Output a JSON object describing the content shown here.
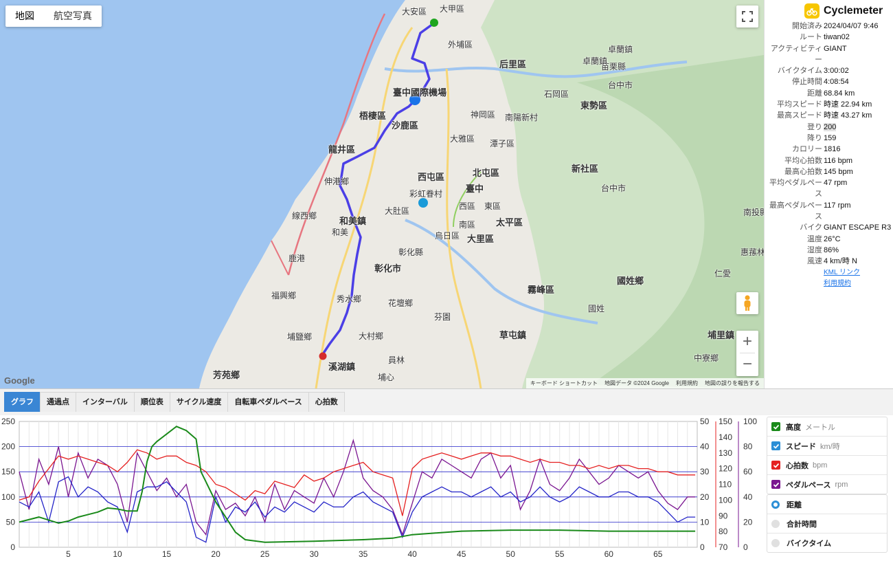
{
  "map": {
    "mode_buttons": [
      "地図",
      "航空写真"
    ],
    "google_label": "Google",
    "attribution": [
      "キーボード ショートカット",
      "地図データ ©2024 Google",
      "利用規約",
      "地図の誤りを報告する"
    ],
    "labels": [
      {
        "t": "大甲區"
      },
      {
        "t": "大安區"
      },
      {
        "t": "外埔區"
      },
      {
        "t": "后里區"
      },
      {
        "t": "卓蘭鎮"
      },
      {
        "t": "苗栗縣"
      },
      {
        "t": "卓蘭鎮"
      },
      {
        "t": "臺中國際機場"
      },
      {
        "t": "石岡區"
      },
      {
        "t": "台中市"
      },
      {
        "t": "梧棲區"
      },
      {
        "t": "沙鹿區"
      },
      {
        "t": "神岡區"
      },
      {
        "t": "南陽新村"
      },
      {
        "t": "東勢區"
      },
      {
        "t": "大雅區"
      },
      {
        "t": "潭子區"
      },
      {
        "t": "龍井區"
      },
      {
        "t": "西屯區"
      },
      {
        "t": "北屯區"
      },
      {
        "t": "新社區"
      },
      {
        "t": "伸港鄉"
      },
      {
        "t": "臺中"
      },
      {
        "t": "彩虹眷村"
      },
      {
        "t": "台中市"
      },
      {
        "t": "線西鄉"
      },
      {
        "t": "大肚區"
      },
      {
        "t": "西區"
      },
      {
        "t": "東區"
      },
      {
        "t": "和美鎮"
      },
      {
        "t": "南區"
      },
      {
        "t": "太平區"
      },
      {
        "t": "和美"
      },
      {
        "t": "烏日區"
      },
      {
        "t": "大里區"
      },
      {
        "t": "南投縣"
      },
      {
        "t": "鹿港"
      },
      {
        "t": "彰化市"
      },
      {
        "t": "彰化縣"
      },
      {
        "t": "霧峰區"
      },
      {
        "t": "國姓鄉"
      },
      {
        "t": "惠蓀林"
      },
      {
        "t": "福興鄉"
      },
      {
        "t": "秀水鄉"
      },
      {
        "t": "花壇鄉"
      },
      {
        "t": "國姓"
      },
      {
        "t": "芬園"
      },
      {
        "t": "埔鹽鄉"
      },
      {
        "t": "大村鄉"
      },
      {
        "t": "草屯鎮"
      },
      {
        "t": "埔里鎮"
      },
      {
        "t": "溪湖鎮"
      },
      {
        "t": "員林"
      },
      {
        "t": "芳苑鄉"
      },
      {
        "t": "埔心"
      },
      {
        "t": "仁愛"
      },
      {
        "t": "中寮鄉"
      }
    ]
  },
  "panel": {
    "brand": "Cyclemeter",
    "stats": [
      {
        "k": "開始済み",
        "v": "2024/04/07 9:46"
      },
      {
        "k": "ルート",
        "v": "tiwan02"
      },
      {
        "k": "アクティビティー",
        "v": "GIANT"
      },
      {
        "k": "バイクタイム",
        "v": "3:00:02"
      },
      {
        "k": "停止時間",
        "v": "4:08:54"
      },
      {
        "k": "距離",
        "v": "68.84 km"
      },
      {
        "k": "平均スピード",
        "v": "時速 22.94 km"
      },
      {
        "k": "最高スピード",
        "v": "時速 43.27 km"
      },
      {
        "k": "登り",
        "v": "200",
        "hl": true
      },
      {
        "k": "降り",
        "v": "159"
      },
      {
        "k": "カロリー",
        "v": "1816"
      },
      {
        "k": "平均心拍数",
        "v": "116 bpm"
      },
      {
        "k": "最高心拍数",
        "v": "145 bpm"
      },
      {
        "k": "平均ペダルペース",
        "v": "47 rpm"
      },
      {
        "k": "最高ペダルペース",
        "v": "117 rpm"
      },
      {
        "k": "バイク",
        "v": "GIANT ESCAPE R3"
      },
      {
        "k": "温度",
        "v": "26°C"
      },
      {
        "k": "湿度",
        "v": "86%"
      },
      {
        "k": "風速",
        "v": "4 km/時 N"
      }
    ],
    "links": [
      "KML リンク",
      "利用規約"
    ]
  },
  "tabs": [
    "グラフ",
    "通過点",
    "インターバル",
    "順位表",
    "サイクル速度",
    "自転車ペダルベース",
    "心拍数"
  ],
  "legend": {
    "series": [
      {
        "name": "高度",
        "unit": "メートル",
        "color": "#1a8a1a"
      },
      {
        "name": "スピード",
        "unit": "km/時",
        "color": "#2c8fd6"
      },
      {
        "name": "心拍数",
        "unit": "bpm",
        "color": "#e52020"
      },
      {
        "name": "ペダルペース",
        "unit": "rpm",
        "color": "#7a1590"
      }
    ],
    "xaxis_options": [
      {
        "name": "距離",
        "selected": true
      },
      {
        "name": "合計時間",
        "selected": false
      },
      {
        "name": "バイクタイム",
        "selected": false
      }
    ]
  },
  "chart_data": {
    "type": "line",
    "xlabel": "",
    "xlim": [
      0,
      69
    ],
    "x_ticks": [
      5,
      10,
      15,
      20,
      25,
      30,
      35,
      40,
      45,
      50,
      55,
      60,
      65
    ],
    "axes": {
      "altitude": {
        "ticks": [
          0,
          50,
          100,
          150,
          200,
          250
        ],
        "lim": [
          0,
          250
        ]
      },
      "speed": {
        "ticks": [
          0,
          10,
          20,
          30,
          40,
          50
        ],
        "lim": [
          0,
          50
        ]
      },
      "heart_rate": {
        "ticks": [
          70,
          80,
          90,
          100,
          110,
          120,
          130,
          140,
          150
        ],
        "lim": [
          70,
          150
        ]
      },
      "cadence": {
        "ticks": [
          0,
          20,
          40,
          60,
          80,
          100
        ],
        "lim": [
          0,
          100
        ]
      }
    },
    "series": [
      {
        "name": "高度",
        "axis": "altitude",
        "x": [
          0,
          2,
          4,
          5,
          6,
          8,
          9,
          10,
          11,
          12,
          12.5,
          13,
          13.5,
          14,
          15,
          16,
          17,
          18,
          18.5,
          19,
          20,
          21,
          22,
          23,
          25,
          30,
          35,
          38,
          40,
          45,
          50,
          55,
          60,
          65,
          68.8
        ],
        "values": [
          50,
          60,
          48,
          52,
          60,
          70,
          78,
          76,
          72,
          72,
          110,
          170,
          200,
          210,
          225,
          240,
          232,
          215,
          150,
          130,
          90,
          60,
          30,
          15,
          10,
          12,
          15,
          18,
          25,
          32,
          34,
          34,
          32,
          32,
          32
        ]
      },
      {
        "name": "スピード",
        "axis": "speed",
        "x": [
          0,
          1,
          2,
          3,
          4,
          5,
          6,
          7,
          8,
          9,
          10,
          11,
          12,
          13,
          14,
          15,
          16,
          17,
          18,
          19,
          20,
          21,
          22,
          23,
          24,
          25,
          26,
          27,
          28,
          29,
          30,
          31,
          32,
          33,
          34,
          35,
          36,
          37,
          38,
          39,
          40,
          41,
          42,
          43,
          44,
          45,
          46,
          47,
          48,
          49,
          50,
          51,
          52,
          53,
          54,
          55,
          56,
          57,
          58,
          59,
          60,
          61,
          62,
          63,
          64,
          65,
          66,
          67,
          68,
          68.8
        ],
        "values": [
          18,
          16,
          22,
          10,
          26,
          28,
          20,
          24,
          22,
          18,
          16,
          6,
          22,
          24,
          24,
          26,
          22,
          18,
          4,
          2,
          20,
          10,
          16,
          14,
          18,
          12,
          16,
          14,
          18,
          16,
          14,
          18,
          16,
          16,
          20,
          22,
          18,
          16,
          14,
          4,
          14,
          20,
          22,
          24,
          22,
          22,
          20,
          22,
          24,
          20,
          22,
          18,
          20,
          24,
          20,
          18,
          20,
          24,
          22,
          20,
          20,
          22,
          22,
          20,
          20,
          18,
          14,
          10,
          12,
          12
        ]
      },
      {
        "name": "心拍数",
        "axis": "heart_rate",
        "x": [
          0,
          1,
          2,
          3,
          4,
          5,
          6,
          7,
          8,
          9,
          10,
          11,
          12,
          13,
          14,
          15,
          16,
          17,
          18,
          19,
          20,
          21,
          22,
          23,
          24,
          25,
          26,
          27,
          28,
          29,
          30,
          31,
          32,
          33,
          34,
          35,
          36,
          37,
          38,
          39,
          40,
          41,
          42,
          43,
          44,
          45,
          46,
          47,
          48,
          49,
          50,
          51,
          52,
          53,
          54,
          55,
          56,
          57,
          58,
          59,
          60,
          61,
          62,
          63,
          64,
          65,
          66,
          67,
          68,
          68.8
        ],
        "values": [
          100,
          102,
          112,
          120,
          128,
          126,
          128,
          126,
          124,
          122,
          118,
          124,
          132,
          130,
          126,
          128,
          128,
          124,
          122,
          118,
          110,
          108,
          104,
          100,
          106,
          104,
          112,
          110,
          108,
          116,
          112,
          114,
          118,
          120,
          122,
          124,
          118,
          116,
          114,
          90,
          120,
          126,
          128,
          130,
          128,
          126,
          128,
          130,
          130,
          128,
          128,
          126,
          124,
          126,
          124,
          124,
          122,
          122,
          120,
          122,
          120,
          122,
          122,
          120,
          120,
          118,
          118,
          116,
          116,
          116
        ]
      },
      {
        "name": "ペダルペース",
        "axis": "cadence",
        "x": [
          0,
          1,
          2,
          3,
          4,
          5,
          6,
          7,
          8,
          9,
          10,
          11,
          12,
          13,
          14,
          15,
          16,
          17,
          18,
          19,
          20,
          21,
          22,
          23,
          24,
          25,
          26,
          27,
          28,
          29,
          30,
          31,
          32,
          33,
          34,
          35,
          36,
          37,
          38,
          39,
          40,
          41,
          42,
          43,
          44,
          45,
          46,
          47,
          48,
          49,
          50,
          51,
          52,
          53,
          54,
          55,
          56,
          57,
          58,
          59,
          60,
          61,
          62,
          63,
          64,
          65,
          66,
          67,
          68,
          68.8
        ],
        "values": [
          60,
          30,
          70,
          50,
          80,
          40,
          75,
          55,
          70,
          65,
          50,
          20,
          75,
          60,
          45,
          55,
          40,
          50,
          20,
          10,
          45,
          30,
          35,
          25,
          40,
          20,
          50,
          30,
          45,
          40,
          35,
          55,
          40,
          60,
          85,
          55,
          45,
          40,
          30,
          10,
          35,
          60,
          55,
          70,
          65,
          60,
          55,
          70,
          75,
          55,
          65,
          30,
          45,
          70,
          50,
          45,
          55,
          70,
          60,
          50,
          55,
          65,
          60,
          55,
          60,
          45,
          35,
          30,
          40,
          40
        ]
      }
    ]
  }
}
